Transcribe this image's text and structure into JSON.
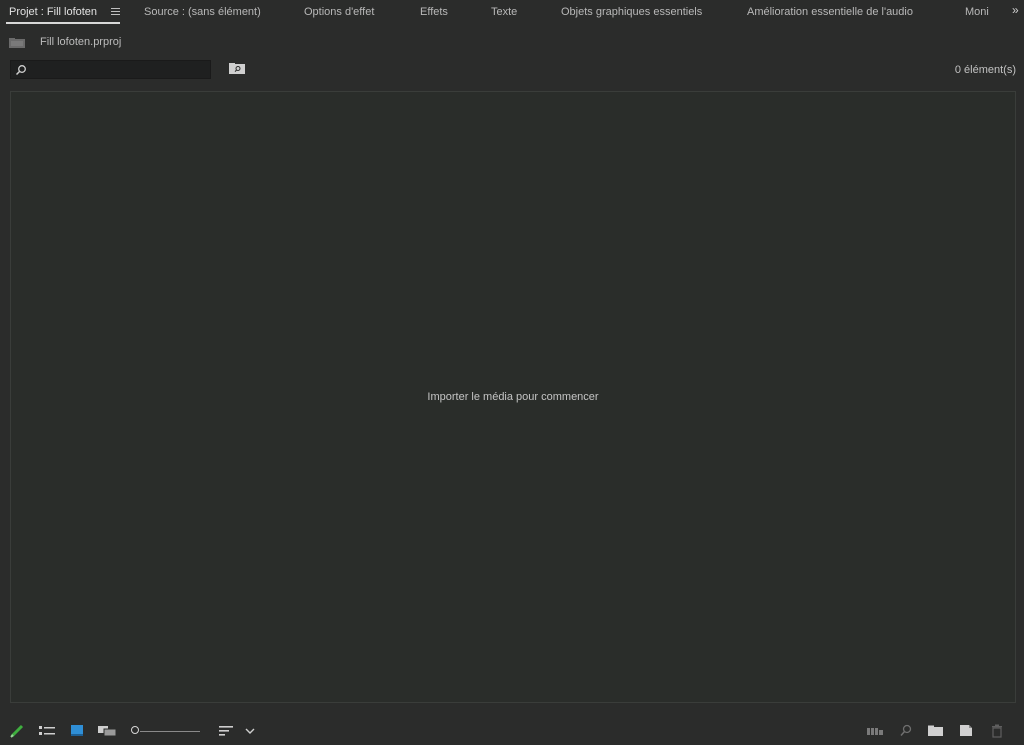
{
  "tabs": [
    {
      "label": "Projet : Fill lofoten",
      "active": true
    },
    {
      "label": "Source : (sans élément)"
    },
    {
      "label": "Options d'effet"
    },
    {
      "label": "Effets"
    },
    {
      "label": "Texte"
    },
    {
      "label": "Objets graphiques essentiels"
    },
    {
      "label": "Amélioration essentielle de l'audio"
    },
    {
      "label": "Moni"
    }
  ],
  "overflow_label": "»",
  "project": {
    "file_name": "Fill lofoten.prproj"
  },
  "search": {
    "placeholder": ""
  },
  "item_count": "0 élément(s)",
  "media_area": {
    "empty_message": "Importer le média pour commencer"
  },
  "colors": {
    "accent_green": "#3fae3f",
    "accent_blue": "#2f8fd6",
    "background": "#2b2c2b",
    "panel": "#2a2d2a"
  },
  "icons": {
    "tab_menu": "hamburger-icon",
    "project": "folder-icon",
    "search": "search-icon",
    "bin_search": "bin-search-icon",
    "overflow": "double-chevron-right-icon",
    "bottom_toolbar": [
      "pencil-icon",
      "list-view-icon",
      "icon-view-icon",
      "freeform-view-icon",
      "zoom-slider",
      "sort-icon",
      "chevron-down-icon",
      "automate-to-sequence-icon",
      "find-icon",
      "new-bin-icon",
      "new-item-icon",
      "trash-icon"
    ]
  }
}
